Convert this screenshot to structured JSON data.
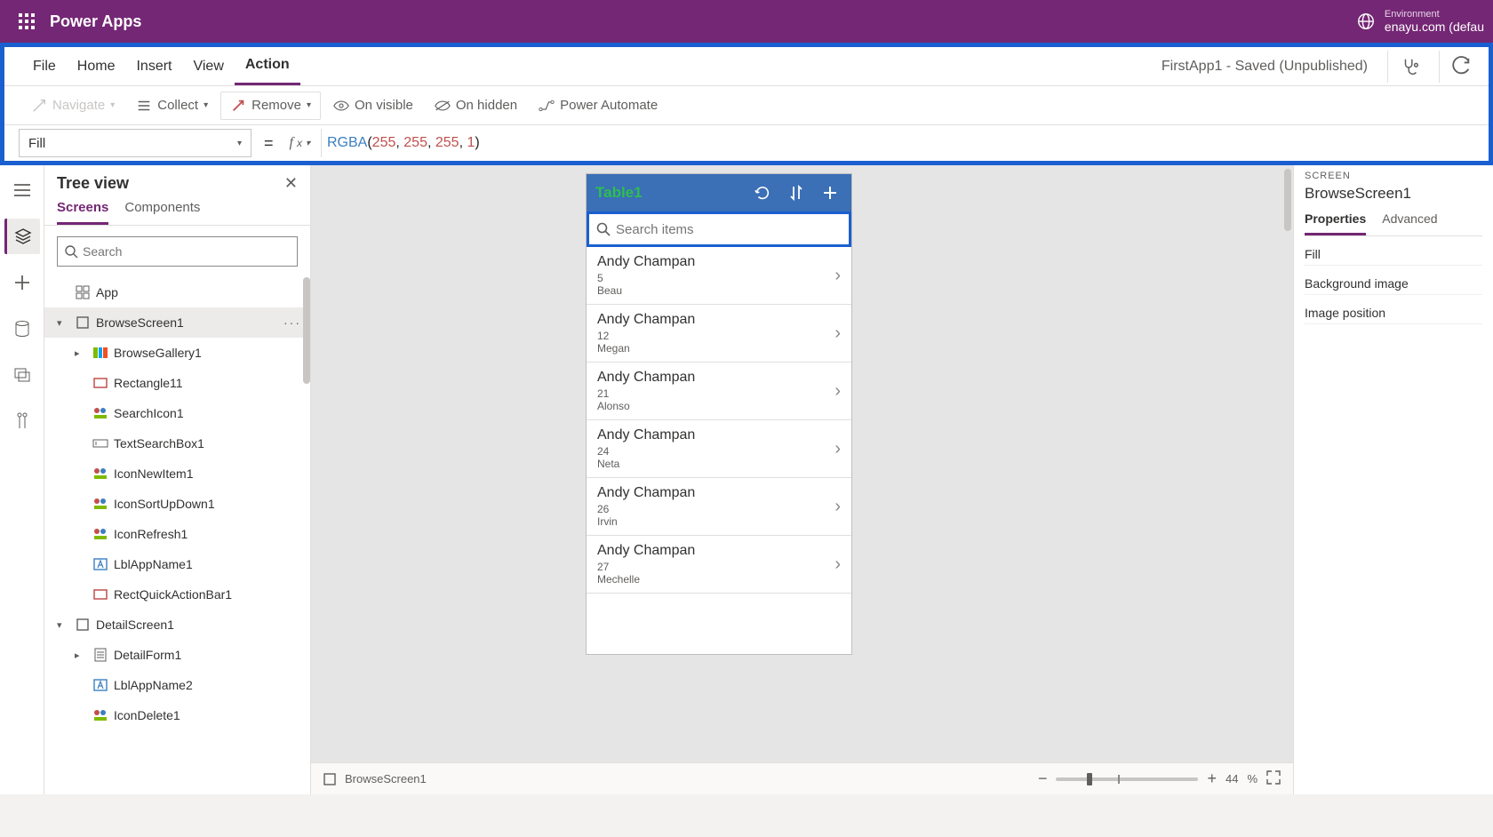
{
  "topbar": {
    "app_name": "Power Apps",
    "environment_label": "Environment",
    "environment_value": "enayu.com (defau"
  },
  "menubar": {
    "tabs": [
      "File",
      "Home",
      "Insert",
      "View",
      "Action"
    ],
    "active_index": 4,
    "status": "FirstApp1 - Saved (Unpublished)"
  },
  "action_toolbar": {
    "navigate": "Navigate",
    "collect": "Collect",
    "remove": "Remove",
    "on_visible": "On visible",
    "on_hidden": "On hidden",
    "power_automate": "Power Automate"
  },
  "formula": {
    "property": "Fill",
    "fn": "RGBA",
    "args": [
      "255",
      "255",
      "255",
      "1"
    ]
  },
  "treeview": {
    "title": "Tree view",
    "tabs": [
      "Screens",
      "Components"
    ],
    "active_tab": 0,
    "search_placeholder": "Search",
    "items": [
      {
        "level": 0,
        "kind": "app-icon",
        "label": "App",
        "expand": ""
      },
      {
        "level": 0,
        "kind": "screen-icon",
        "label": "BrowseScreen1",
        "expand": "▾",
        "selected": true,
        "ellipsis": true
      },
      {
        "level": 1,
        "kind": "gallery-icon",
        "label": "BrowseGallery1",
        "expand": "▸"
      },
      {
        "level": 1,
        "kind": "rect-icon",
        "label": "Rectangle11",
        "expand": ""
      },
      {
        "level": 1,
        "kind": "icon-icon",
        "label": "SearchIcon1",
        "expand": ""
      },
      {
        "level": 1,
        "kind": "textbox-icon",
        "label": "TextSearchBox1",
        "expand": ""
      },
      {
        "level": 1,
        "kind": "icon-icon",
        "label": "IconNewItem1",
        "expand": ""
      },
      {
        "level": 1,
        "kind": "icon-icon",
        "label": "IconSortUpDown1",
        "expand": ""
      },
      {
        "level": 1,
        "kind": "icon-icon",
        "label": "IconRefresh1",
        "expand": ""
      },
      {
        "level": 1,
        "kind": "label-icon",
        "label": "LblAppName1",
        "expand": ""
      },
      {
        "level": 1,
        "kind": "rect-icon",
        "label": "RectQuickActionBar1",
        "expand": ""
      },
      {
        "level": 0,
        "kind": "screen-icon",
        "label": "DetailScreen1",
        "expand": "▾"
      },
      {
        "level": 1,
        "kind": "form-icon",
        "label": "DetailForm1",
        "expand": "▸"
      },
      {
        "level": 1,
        "kind": "label-icon",
        "label": "LblAppName2",
        "expand": ""
      },
      {
        "level": 1,
        "kind": "icon-icon",
        "label": "IconDelete1",
        "expand": ""
      }
    ]
  },
  "canvas": {
    "header_title": "Table1",
    "search_placeholder": "Search items",
    "rows": [
      {
        "title": "Andy Champan",
        "sub1": "5",
        "sub2": "Beau"
      },
      {
        "title": "Andy Champan",
        "sub1": "12",
        "sub2": "Megan"
      },
      {
        "title": "Andy Champan",
        "sub1": "21",
        "sub2": "Alonso"
      },
      {
        "title": "Andy Champan",
        "sub1": "24",
        "sub2": "Neta"
      },
      {
        "title": "Andy Champan",
        "sub1": "26",
        "sub2": "Irvin"
      },
      {
        "title": "Andy Champan",
        "sub1": "27",
        "sub2": "Mechelle"
      }
    ]
  },
  "footer": {
    "breadcrumb": "BrowseScreen1",
    "zoom_value": "44",
    "zoom_suffix": "%"
  },
  "properties": {
    "caption": "SCREEN",
    "object": "BrowseScreen1",
    "tabs": [
      "Properties",
      "Advanced"
    ],
    "active_tab": 0,
    "rows": [
      "Fill",
      "Background image",
      "Image position"
    ]
  }
}
